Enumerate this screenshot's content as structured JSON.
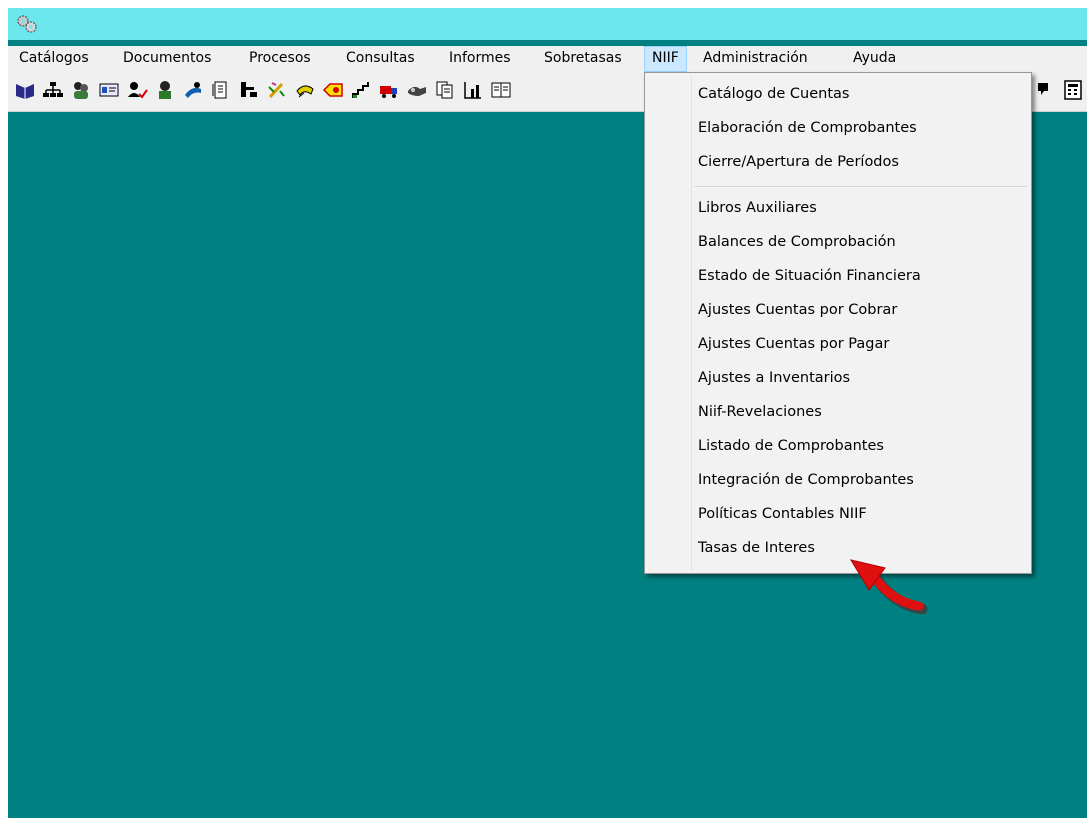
{
  "menubar": {
    "items": [
      {
        "label": "Catálogos"
      },
      {
        "label": "Documentos"
      },
      {
        "label": "Procesos"
      },
      {
        "label": "Consultas"
      },
      {
        "label": "Informes"
      },
      {
        "label": "Sobretasas"
      },
      {
        "label": "NIIF"
      },
      {
        "label": "Administración"
      },
      {
        "label": "Ayuda"
      }
    ],
    "active": "NIIF"
  },
  "toolbar": {
    "icons": [
      "book-icon",
      "org-chart-icon",
      "people-icon",
      "card-icon",
      "user-check-icon",
      "person-icon",
      "hand-icon",
      "document-icon",
      "tree-icon",
      "edit-icon",
      "hands-icon",
      "tag-icon",
      "stairs-icon",
      "truck-icon",
      "handshake-icon",
      "files-icon",
      "chart-icon",
      "ledger-icon",
      "help-icon",
      "calculator-icon"
    ]
  },
  "niif_menu": {
    "group1": [
      {
        "label": "Catálogo de Cuentas"
      },
      {
        "label": "Elaboración de Comprobantes"
      },
      {
        "label": "Cierre/Apertura de Períodos"
      }
    ],
    "group2": [
      {
        "label": "Libros Auxiliares"
      },
      {
        "label": "Balances de Comprobación"
      },
      {
        "label": "Estado de Situación Financiera"
      },
      {
        "label": "Ajustes Cuentas por Cobrar"
      },
      {
        "label": "Ajustes Cuentas por Pagar"
      },
      {
        "label": "Ajustes a Inventarios"
      },
      {
        "label": "Niif-Revelaciones"
      },
      {
        "label": "Listado de Comprobantes"
      },
      {
        "label": "Integración de Comprobantes"
      },
      {
        "label": "Políticas Contables NIIF"
      },
      {
        "label": "Tasas de Interes"
      }
    ]
  },
  "colors": {
    "titlebar": "#6ae6ec",
    "workspace": "#008080",
    "menu_highlight": "#cce8ff",
    "annotation_arrow": "#e01010"
  }
}
